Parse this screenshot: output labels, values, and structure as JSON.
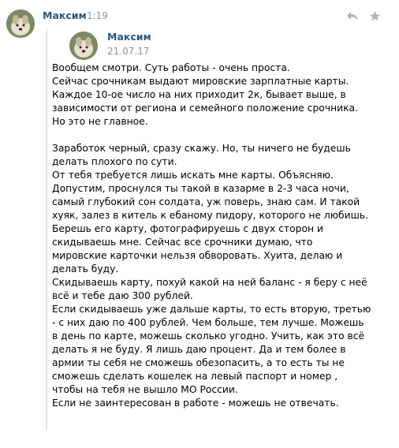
{
  "message": {
    "author": "Максим",
    "time": "1:19",
    "avatar_icon": "dog-avatar-photo",
    "actions": {
      "reply_icon": "reply-icon",
      "star_icon": "star-icon"
    }
  },
  "forwarded": {
    "author": "Максим",
    "date": "21.07.17",
    "paragraphs": [
      [
        "Вообщем смотри. Суть работы - очень проста.",
        "Сейчас срочникам выдают мировские зарплатные карты.",
        "Каждое 10-ое число на них приходит 2к, бывает выше, в",
        "зависимости от региона и семейного положение срочника.",
        "Но это не главное."
      ],
      [
        "Заработок черный, сразу скажу. Но, ты ничего не будешь",
        "делать плохого по сути.",
        "От тебя требуется лишь искать мне карты. Объясняю.",
        "Допустим, проснулся ты такой в казарме в 2-3 часа ночи,",
        "самый глубокий сон солдата, уж поверь, знаю сам. И такой",
        "хуяк, залез в китель к ебаному пидору, которого не любишь.",
        "Берешь его карту, фотографируешь с двух сторон и",
        "скидываешь мне. Сейчас все срочники думаю, что",
        "мировские карточки нельзя обворовать. Хуита, делаю и",
        "делать буду.",
        "Скидываешь карту, похуй какой на ней баланс - я беру с неё",
        "всё и тебе даю 300 рублей.",
        "Если скидываешь уже дальше карты, то есть вторую, третью",
        "- с них даю по 400 рублей. Чем больше, тем лучше. Можешь",
        "в день по карте, можешь сколько угодно. Учить, как это всё",
        "делать я не буду. Я лишь даю процент. Да и тем более в",
        "армии ты себя не сможешь обезопасить, а то есть ты не",
        "сможешь сделать кошелек на левый паспорт и номер ,",
        " чтобы на тебя не вышло МО России.",
        "Если не заинтересован в работе - можешь не отвечать."
      ]
    ]
  },
  "colors": {
    "author": "#2a5885",
    "muted": "#939393",
    "quote_border": "#dfe6ec",
    "icon": "#a9b4bf"
  }
}
